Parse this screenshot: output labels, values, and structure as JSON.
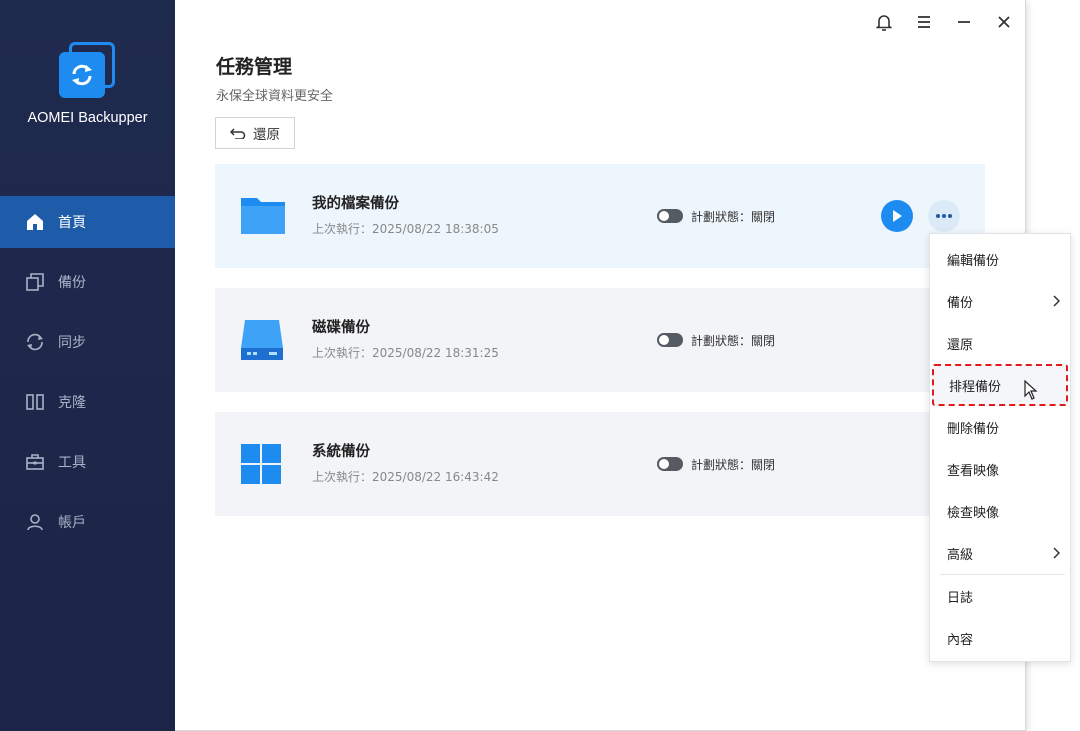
{
  "app": {
    "brand": "AOMEI Backupper"
  },
  "sidebar": {
    "items": [
      {
        "label": "首頁",
        "icon": "home-icon",
        "active": true
      },
      {
        "label": "備份",
        "icon": "backup-icon",
        "active": false
      },
      {
        "label": "同步",
        "icon": "sync-icon",
        "active": false
      },
      {
        "label": "克隆",
        "icon": "clone-icon",
        "active": false
      },
      {
        "label": "工具",
        "icon": "tools-icon",
        "active": false
      },
      {
        "label": "帳戶",
        "icon": "account-icon",
        "active": false
      }
    ]
  },
  "titlebar": {
    "icons": [
      "bell-icon",
      "menu-icon",
      "minimize-icon",
      "close-icon"
    ]
  },
  "main": {
    "title": "任務管理",
    "subtitle": "永保全球資料更安全",
    "restore_label": "還原"
  },
  "tasks": [
    {
      "name": "我的檔案備份",
      "last_run": "上次執行：2025/08/22 18:38:05",
      "schedule": "計劃狀態：關閉",
      "icon": "folder-icon",
      "selected": true
    },
    {
      "name": "磁碟備份",
      "last_run": "上次執行：2025/08/22 18:31:25",
      "schedule": "計劃狀態：關閉",
      "icon": "disk-icon",
      "selected": false
    },
    {
      "name": "系統備份",
      "last_run": "上次執行：2025/08/22 16:43:42",
      "schedule": "計劃狀態：關閉",
      "icon": "windows-icon",
      "selected": false
    }
  ],
  "context_menu": {
    "items": [
      {
        "label": "編輯備份",
        "submenu": false
      },
      {
        "label": "備份",
        "submenu": true
      },
      {
        "label": "還原",
        "submenu": false
      },
      {
        "label": "排程備份",
        "submenu": false,
        "highlighted": true
      },
      {
        "label": "刪除備份",
        "submenu": false
      },
      {
        "label": "查看映像",
        "submenu": false
      },
      {
        "label": "檢查映像",
        "submenu": false
      },
      {
        "label": "高級",
        "submenu": true
      },
      {
        "label": "日誌",
        "submenu": false
      },
      {
        "label": "內容",
        "submenu": false
      }
    ]
  },
  "colors": {
    "sidebar_bg": "#1f2a4f",
    "active_nav": "#1e5ba8",
    "accent": "#1e8bf0",
    "highlight_border": "#e31919"
  }
}
